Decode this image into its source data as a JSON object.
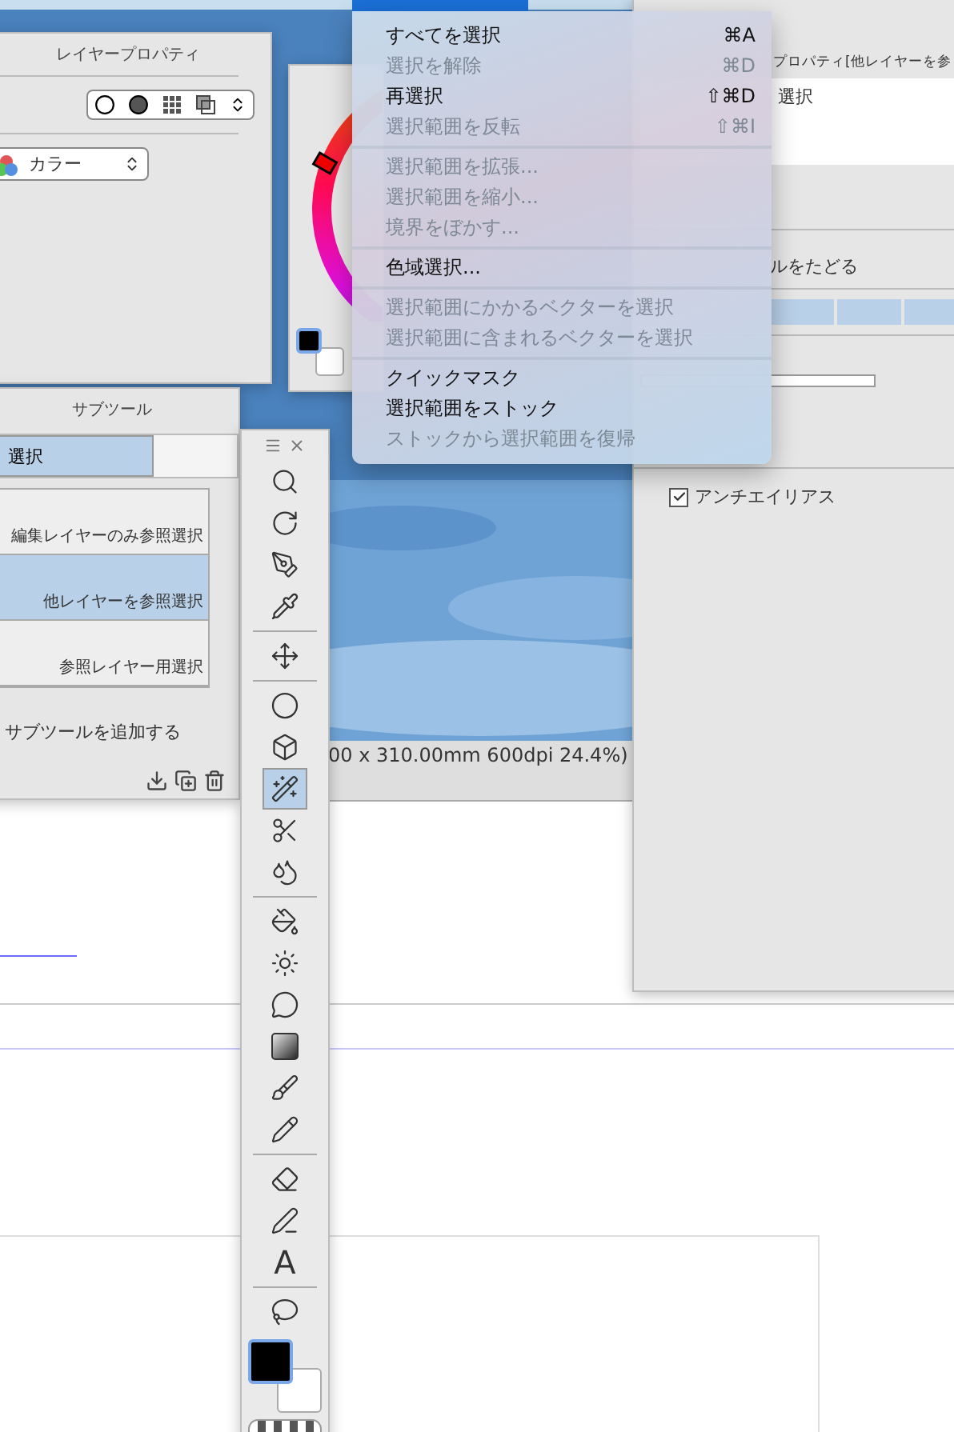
{
  "layer_property": {
    "title": "レイヤープロパティ",
    "mode": "カラー"
  },
  "subtool": {
    "title": "サブツール",
    "tab": {
      "label": "選択",
      "selected": true
    },
    "items": [
      {
        "label": "編集レイヤーのみ参照選択",
        "selected": false
      },
      {
        "label": "他レイヤーを参照選択",
        "selected": true
      },
      {
        "label": "参照レイヤー用選択",
        "selected": false
      }
    ],
    "add_label": "サブツールを追加する"
  },
  "toolbar": {
    "tools": [
      {
        "selected": false
      },
      {
        "selected": false
      },
      {
        "selected": false
      },
      {
        "selected": false
      },
      {
        "selected": false
      },
      {
        "selected": false
      },
      {
        "selected": false
      },
      {
        "selected": true
      },
      {
        "selected": false
      },
      {
        "selected": false
      },
      {
        "selected": false
      },
      {
        "selected": false
      },
      {
        "selected": false
      },
      {
        "selected": false
      },
      {
        "selected": false
      },
      {
        "selected": false
      },
      {
        "selected": false
      },
      {
        "selected": false
      },
      {
        "selected": false,
        "label": "A"
      },
      {
        "selected": false
      }
    ]
  },
  "canvas": {
    "status": "00 x 310.00mm 600dpi 24.4%)"
  },
  "tool_property": {
    "title": "プロパティ[他レイヤーを参",
    "field": "選択",
    "option": "ルをたどる",
    "antialias": {
      "label": "アンチエイリアス",
      "checked": true
    }
  },
  "menu": {
    "groups": [
      [
        {
          "label": "すべてを選択",
          "shortcut": "⌘A",
          "disabled": false
        },
        {
          "label": "選択を解除",
          "shortcut": "⌘D",
          "disabled": true
        },
        {
          "label": "再選択",
          "shortcut": "⇧⌘D",
          "disabled": false
        },
        {
          "label": "選択範囲を反転",
          "shortcut": "⇧⌘I",
          "disabled": true
        }
      ],
      [
        {
          "label": "選択範囲を拡張...",
          "disabled": true
        },
        {
          "label": "選択範囲を縮小...",
          "disabled": true
        },
        {
          "label": "境界をぼかす...",
          "disabled": true
        }
      ],
      [
        {
          "label": "色域選択...",
          "disabled": false
        }
      ],
      [
        {
          "label": "選択範囲にかかるベクターを選択",
          "disabled": true
        },
        {
          "label": "選択範囲に含まれるベクターを選択",
          "disabled": true
        }
      ],
      [
        {
          "label": "クイックマスク",
          "disabled": false
        },
        {
          "label": "選択範囲をストック",
          "disabled": false
        },
        {
          "label": "ストックから選択範囲を復帰",
          "disabled": true
        }
      ]
    ]
  }
}
